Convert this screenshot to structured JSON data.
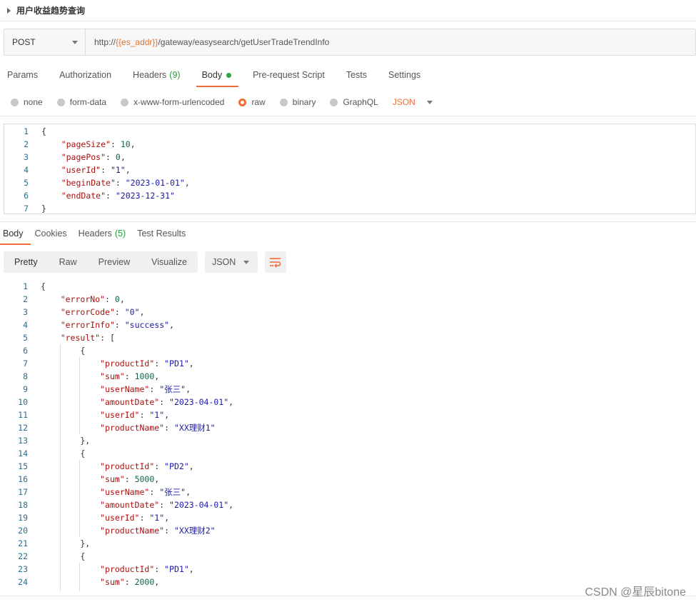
{
  "request": {
    "name": "用户收益趋势查询",
    "method": "POST",
    "url": {
      "prefix": "http://",
      "variable": "{{es_addr}}",
      "path": "/gateway/easysearch/getUserTradeTrendInfo"
    }
  },
  "request_tabs": [
    {
      "label": "Params",
      "count": ""
    },
    {
      "label": "Authorization",
      "count": ""
    },
    {
      "label": "Headers",
      "count": "(9)"
    },
    {
      "label": "Body",
      "count": "",
      "active": true
    },
    {
      "label": "Pre-request Script",
      "count": ""
    },
    {
      "label": "Tests",
      "count": ""
    },
    {
      "label": "Settings",
      "count": ""
    }
  ],
  "body_types": [
    {
      "label": "none",
      "selected": false
    },
    {
      "label": "form-data",
      "selected": false
    },
    {
      "label": "x-www-form-urlencoded",
      "selected": false
    },
    {
      "label": "raw",
      "selected": true
    },
    {
      "label": "binary",
      "selected": false
    },
    {
      "label": "GraphQL",
      "selected": false
    }
  ],
  "body_format": "JSON",
  "request_body_lines": [
    "{",
    "    \"pageSize\": 10,",
    "    \"pagePos\": 0,",
    "    \"userId\": \"1\",",
    "    \"beginDate\": \"2023-01-01\",",
    "    \"endDate\": \"2023-12-31\"",
    "}"
  ],
  "response_tabs": [
    {
      "label": "Body",
      "count": "",
      "active": true
    },
    {
      "label": "Cookies",
      "count": ""
    },
    {
      "label": "Headers",
      "count": "(5)"
    },
    {
      "label": "Test Results",
      "count": ""
    }
  ],
  "view_modes": [
    {
      "label": "Pretty",
      "active": true
    },
    {
      "label": "Raw",
      "active": false
    },
    {
      "label": "Preview",
      "active": false
    },
    {
      "label": "Visualize",
      "active": false
    }
  ],
  "response_format": "JSON",
  "response_body_lines": [
    "{",
    "    \"errorNo\": 0,",
    "    \"errorCode\": \"0\",",
    "    \"errorInfo\": \"success\",",
    "    \"result\": [",
    "        {",
    "            \"productId\": \"PD1\",",
    "            \"sum\": 1000,",
    "            \"userName\": \"张三\",",
    "            \"amountDate\": \"2023-04-01\",",
    "            \"userId\": \"1\",",
    "            \"productName\": \"XX理财1\"",
    "        },",
    "        {",
    "            \"productId\": \"PD2\",",
    "            \"sum\": 5000,",
    "            \"userName\": \"张三\",",
    "            \"amountDate\": \"2023-04-01\",",
    "            \"userId\": \"1\",",
    "            \"productName\": \"XX理财2\"",
    "        },",
    "        {",
    "            \"productId\": \"PD1\",",
    "            \"sum\": 2000,"
  ],
  "watermark": "CSDN @星辰bitone",
  "colors": {
    "accent": "#f26b3a",
    "count": "#2a9a3c",
    "dot": "#28a745"
  }
}
